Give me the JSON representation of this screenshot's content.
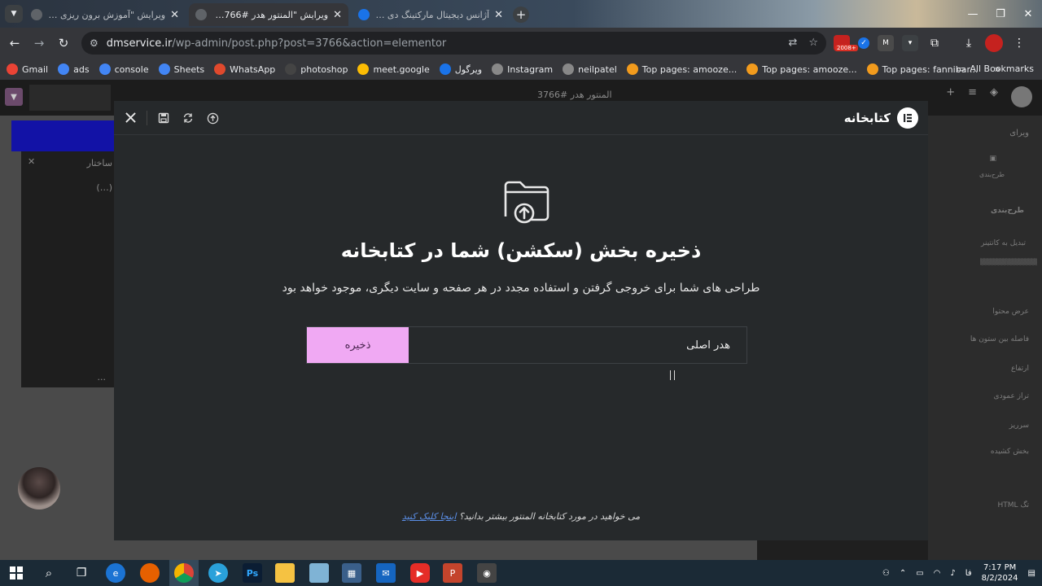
{
  "browser": {
    "tabs": [
      {
        "title": "ویرایش \"آموزش برون ریزی و درو...",
        "active": false
      },
      {
        "title": "ویرایش \"المنتور هدر #3766\" با ال...",
        "active": true
      },
      {
        "title": "آژانس دیجیتال مارکتینگ دی ام سر...",
        "active": false
      }
    ],
    "url_host": "dmservice.ir",
    "url_path": "/wp-admin/post.php?post=3766&action=elementor",
    "extension_badge": "2008+",
    "bookmarks": [
      {
        "label": "Gmail",
        "icon": "gmail-icon",
        "color": "#ea4335"
      },
      {
        "label": "ads",
        "icon": "google-icon",
        "color": "#4285f4"
      },
      {
        "label": "console",
        "icon": "google-icon",
        "color": "#4285f4"
      },
      {
        "label": "Sheets",
        "icon": "google-icon",
        "color": "#4285f4"
      },
      {
        "label": "WhatsApp",
        "icon": "whatsapp-icon",
        "color": "#e0492d"
      },
      {
        "label": "photoshop",
        "icon": "penguin-icon",
        "color": "#444"
      },
      {
        "label": "meet.google",
        "icon": "meet-icon",
        "color": "#fbbc04"
      },
      {
        "label": "ویرگول",
        "icon": "drop-icon",
        "color": "#1a73e8"
      },
      {
        "label": "Instagram",
        "icon": "globe-icon",
        "color": "#888"
      },
      {
        "label": "neilpatel",
        "icon": "globe-icon",
        "color": "#888"
      },
      {
        "label": "Top pages: amooze...",
        "icon": "ahrefs-icon",
        "color": "#f29b1d"
      },
      {
        "label": "Top pages: amooze...",
        "icon": "ahrefs-icon",
        "color": "#f29b1d"
      },
      {
        "label": "Top pages: fannibar...",
        "icon": "ahrefs-icon",
        "color": "#f29b1d"
      }
    ],
    "all_bookmarks": "All Bookmarks"
  },
  "editor": {
    "doc_title": "المنتور هدر #3766",
    "structure_label": "ساختار",
    "side_items": [
      "ویرای",
      "طرح‌بندی",
      "طرح‌بندی",
      "تبدیل به کانتینر",
      "عرض محتوا",
      "فاصله بین ستون ها",
      "ارتفاع",
      "تراز عمودی",
      "سرریز",
      "بخش کشیده",
      "تگ HTML"
    ]
  },
  "modal": {
    "brand_title": "کتابخانه",
    "title": "ذخیره بخش (سکشن) شما در کتابخانه",
    "description": "طراحی های شما برای خروجی گرفتن و استفاده مجدد در هر صفحه و سایت دیگری، موجود خواهد بود",
    "name_value": "هدر اصلی",
    "save_label": "ذخیره",
    "footer_text": "می خواهید در مورد کتابخانه المنتور بیشتر بدانید؟",
    "footer_link": "اینجا کلیک کنید",
    "accent_color": "#f0a9f3",
    "link_color": "#5b8fe8"
  },
  "taskbar": {
    "language": "فا",
    "time": "7:17 PM",
    "date": "8/2/2024"
  }
}
